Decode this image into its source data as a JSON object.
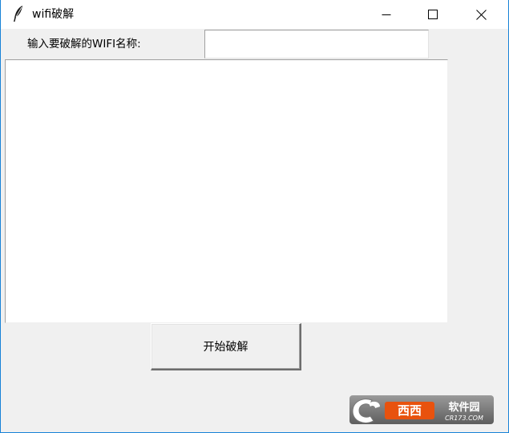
{
  "window": {
    "title": "wifi破解",
    "icon": "feather-icon"
  },
  "form": {
    "wifi_label": "输入要破解的WIFI名称:",
    "wifi_value": "",
    "output_text": "",
    "start_button_label": "开始破解"
  },
  "watermark": {
    "brand_text": "西西软件园",
    "domain_text": "CR173.COM"
  },
  "colors": {
    "accent": "#1883d7",
    "background": "#f0f0f0",
    "watermark_orange": "#e8520e"
  }
}
